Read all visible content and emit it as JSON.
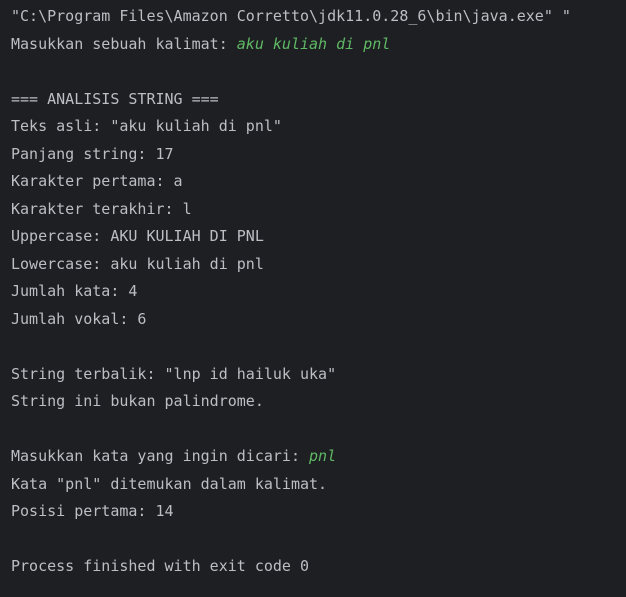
{
  "colors": {
    "background": "#1e1f22",
    "output_text": "#bcbec4",
    "user_input": "#5fb865"
  },
  "console": {
    "lines": [
      {
        "text": "\"C:\\Program Files\\Amazon Corretto\\jdk11.0.28_6\\bin\\java.exe\" \"",
        "input": ""
      },
      {
        "text": "Masukkan sebuah kalimat: ",
        "input": "aku kuliah di pnl"
      },
      {
        "text": "",
        "input": ""
      },
      {
        "text": "=== ANALISIS STRING ===",
        "input": ""
      },
      {
        "text": "Teks asli: \"aku kuliah di pnl\"",
        "input": ""
      },
      {
        "text": "Panjang string: 17",
        "input": ""
      },
      {
        "text": "Karakter pertama: a",
        "input": ""
      },
      {
        "text": "Karakter terakhir: l",
        "input": ""
      },
      {
        "text": "Uppercase: AKU KULIAH DI PNL",
        "input": ""
      },
      {
        "text": "Lowercase: aku kuliah di pnl",
        "input": ""
      },
      {
        "text": "Jumlah kata: 4",
        "input": ""
      },
      {
        "text": "Jumlah vokal: 6",
        "input": ""
      },
      {
        "text": "",
        "input": ""
      },
      {
        "text": "String terbalik: \"lnp id hailuk uka\"",
        "input": ""
      },
      {
        "text": "String ini bukan palindrome.",
        "input": ""
      },
      {
        "text": "",
        "input": ""
      },
      {
        "text": "Masukkan kata yang ingin dicari: ",
        "input": "pnl"
      },
      {
        "text": "Kata \"pnl\" ditemukan dalam kalimat.",
        "input": ""
      },
      {
        "text": "Posisi pertama: 14",
        "input": ""
      },
      {
        "text": "",
        "input": ""
      },
      {
        "text": "Process finished with exit code 0",
        "input": ""
      }
    ]
  }
}
